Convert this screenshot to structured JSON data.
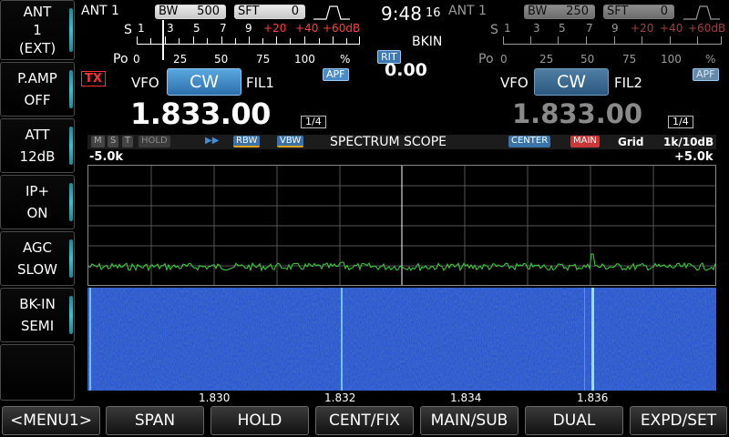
{
  "sidebar": [
    {
      "name": "ANT",
      "value": "1",
      "extra": "(EXT)"
    },
    {
      "name": "P.AMP",
      "value": "OFF"
    },
    {
      "name": "ATT",
      "value": "12dB"
    },
    {
      "name": "IP+",
      "value": "ON"
    },
    {
      "name": "AGC",
      "value": "SLOW"
    },
    {
      "name": "BK-IN",
      "value": "SEMI"
    }
  ],
  "main_rx": {
    "ant": "ANT 1",
    "bw_label": "BW",
    "bw_value": "500",
    "sft_label": "SFT",
    "sft_value": "0",
    "s_label": "S",
    "po_label": "Po",
    "s_ticks": [
      "1",
      "3",
      "5",
      "7",
      "9",
      "+20",
      "+40",
      "+60dB"
    ],
    "po_ticks": [
      "0",
      "25",
      "50",
      "75",
      "100",
      "%"
    ],
    "tx": "TX",
    "vfo": "VFO",
    "mode": "CW",
    "filter": "FIL1",
    "apf": "APF",
    "frequency": "1.833.00",
    "step": "1/4"
  },
  "center": {
    "time": "9:48",
    "time_sec": "16",
    "bkin": "BKIN",
    "rit_label": "RIT",
    "rit_value": "0.00"
  },
  "sub_rx": {
    "ant": "ANT 1",
    "bw_label": "BW",
    "bw_value": "250",
    "sft_label": "SFT",
    "sft_value": "0",
    "s_label": "S",
    "po_label": "Po",
    "s_ticks": [
      "1",
      "3",
      "5",
      "7",
      "9",
      "+20",
      "+40",
      "+60dB"
    ],
    "po_ticks": [
      "0",
      "25",
      "50",
      "75",
      "100",
      "%"
    ],
    "vfo": "VFO",
    "mode": "CW",
    "filter": "FIL2",
    "apf": "APF",
    "frequency": "1.833.00",
    "step": "1/4"
  },
  "scope": {
    "tags_left": [
      "M",
      "S",
      "T",
      "HOLD",
      "▶▶"
    ],
    "rbw": "RBW",
    "vbw": "VBW",
    "title": "SPECTRUM SCOPE",
    "center": "CENTER",
    "main": "MAIN",
    "grid": "Grid",
    "scale": "1k/10dB",
    "span_left": "-5.0k",
    "span_right": "+5.0k",
    "freq_labels": [
      "1.830",
      "1.832",
      "1.834",
      "1.836"
    ]
  },
  "bottom": [
    "<MENU1>",
    "SPAN",
    "HOLD",
    "CENT/FIX",
    "MAIN/SUB",
    "DUAL",
    "EXPD/SET"
  ],
  "colors": {
    "accent": "#2f7fc0",
    "tx_red": "#e02020",
    "trace": "#3dd43d",
    "waterfall": "#1f54d8"
  }
}
